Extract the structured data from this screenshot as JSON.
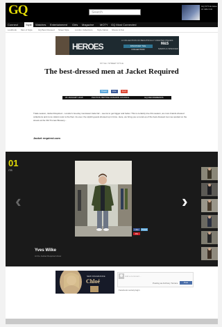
{
  "brand": {
    "logo": "GQ",
    "accent": "#e4dc06"
  },
  "header": {
    "search_placeholder": "Search",
    "promo_text": "GQ STYLE issue on sale now"
  },
  "nav": {
    "items": [
      "Connect",
      "Style",
      "Watches",
      "Entertainment",
      "Girls",
      "Magazine",
      "MOTY",
      "GQ Most Connected"
    ],
    "active": "Style"
  },
  "subnav": {
    "items": [
      "Lookbook",
      "Men of Style",
      "GQ Best Dressed",
      "Street Style",
      "London Collections",
      "Style Nation",
      "Shows & Run"
    ]
  },
  "ad_top": {
    "title": "HEROES",
    "tagline": "A COLLECTION OF BEAUTIFULLY CRAFTED PIECES",
    "cta": "DISCOVER THE COLLECTION",
    "brand": "M&S",
    "sub": "MARKS & SPENCER"
  },
  "article": {
    "section_tag": "STYLE / STREET STYLE",
    "title": "The best-dressed men at Jacket Required",
    "share": [
      "Tweet",
      "Like",
      "G+1"
    ],
    "byline": [
      "23 JANUARY 2015",
      "PHOTOS: BRITISH FASHION COUNCIL",
      "GQ RECOMMENDS"
    ],
    "body": "Trade season, Jacket Required – London's two-day menswear trade fair – seems to get bigger and better. This is certainly true this season, as more brands showed collections and more visitors took to the floor. As ever, the stylish guests showed up in force. Here, we bring you a round-up of the best-dressed men we spotted on the streets at the Old Truman Brewery...",
    "author": "Jacket required.com"
  },
  "gallery": {
    "index": "01",
    "total": "/78",
    "caption_name": "Yves Wilke",
    "caption_sub": "At the Jacket Required show",
    "photo_share": [
      "Like",
      "Tweet",
      "Pin"
    ]
  },
  "ad_bottom": {
    "line": "NEW FRAGRANCE",
    "brand": "Chloé"
  },
  "comments": {
    "placeholder": "Add a comment...",
    "post_label": "Posting as Anthony Terrace",
    "post_button": "Post",
    "plugin": "Facebook social plugin"
  }
}
